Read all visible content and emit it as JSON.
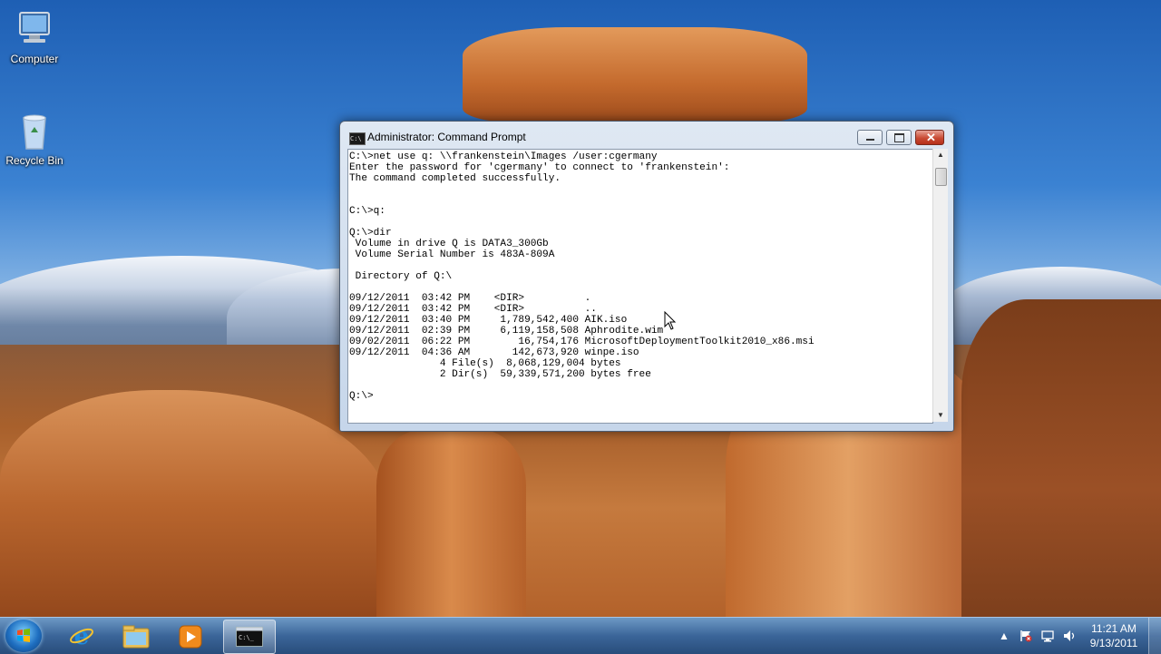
{
  "desktop": {
    "icons": [
      {
        "label": "Computer",
        "icon": "computer-icon"
      },
      {
        "label": "Recycle Bin",
        "icon": "recycle-bin-icon"
      }
    ]
  },
  "window": {
    "title": "Administrator: Command Prompt",
    "buttons": {
      "minimize": "minimize",
      "maximize": "maximize",
      "close": "close"
    },
    "console_lines": [
      "C:\\>net use q: \\\\frankenstein\\Images /user:cgermany",
      "Enter the password for 'cgermany' to connect to 'frankenstein':",
      "The command completed successfully.",
      "",
      "",
      "C:\\>q:",
      "",
      "Q:\\>dir",
      " Volume in drive Q is DATA3_300Gb",
      " Volume Serial Number is 483A-809A",
      "",
      " Directory of Q:\\",
      "",
      "09/12/2011  03:42 PM    <DIR>          .",
      "09/12/2011  03:42 PM    <DIR>          ..",
      "09/12/2011  03:40 PM     1,789,542,400 AIK.iso",
      "09/12/2011  02:39 PM     6,119,158,508 Aphrodite.wim",
      "09/02/2011  06:22 PM        16,754,176 MicrosoftDeploymentToolkit2010_x86.msi",
      "09/12/2011  04:36 AM       142,673,920 winpe.iso",
      "               4 File(s)  8,068,129,004 bytes",
      "               2 Dir(s)  59,339,571,200 bytes free",
      "",
      "Q:\\>"
    ]
  },
  "taskbar": {
    "start_icon": "windows-start-icon",
    "pinned": [
      {
        "icon": "internet-explorer-icon"
      },
      {
        "icon": "windows-explorer-icon"
      },
      {
        "icon": "media-player-icon"
      },
      {
        "icon": "command-prompt-icon",
        "active": true
      }
    ],
    "tray_icons": [
      "show-hidden-icons-arrow-icon",
      "action-center-flag-icon",
      "network-icon",
      "volume-icon"
    ],
    "clock": {
      "time": "11:21 AM",
      "date": "9/13/2011"
    }
  },
  "colors": {
    "taskbar": "#3c6496",
    "console_bg": "#ffffff",
    "console_text": "#000000",
    "close_button": "#c94b34"
  }
}
